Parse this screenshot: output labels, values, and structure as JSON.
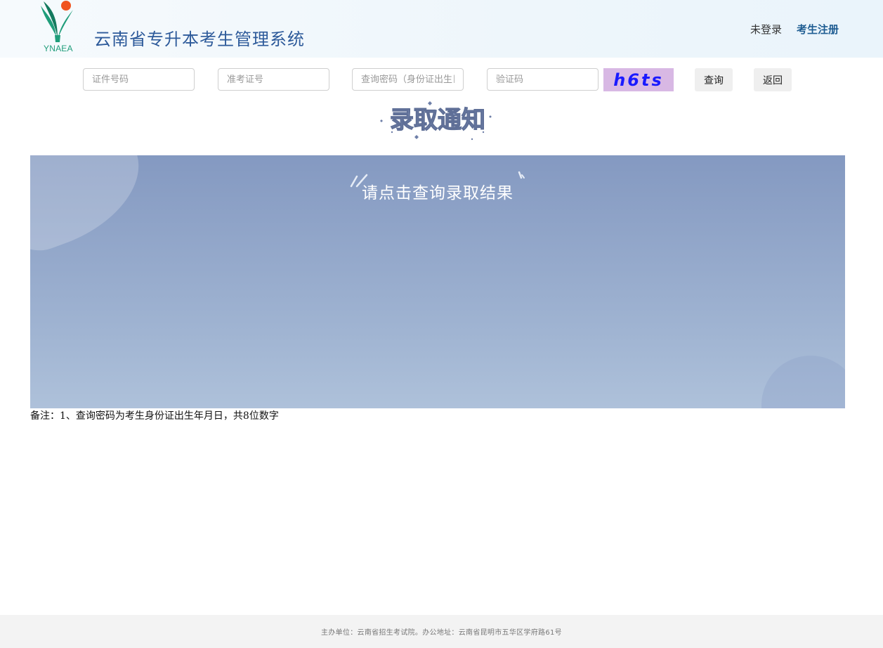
{
  "header": {
    "logo_text": "YNAEA",
    "title": "云南省专升本考生管理系统",
    "login_status": "未登录",
    "register_link": "考生注册"
  },
  "query_form": {
    "id_number_placeholder": "证件号码",
    "exam_ticket_placeholder": "准考证号",
    "password_placeholder": "查询密码（身份证出生日期）",
    "captcha_placeholder": "验证码",
    "captcha_text": "h6ts",
    "query_button": "查询",
    "back_button": "返回"
  },
  "notice": {
    "heading_art_text": "录取通知",
    "banner_text": "请点击查询录取结果"
  },
  "note": "备注：1、查询密码为考生身份证出生年月日，共8位数字",
  "footer": {
    "text": "主办单位：云南省招生考试院。办公地址：云南省昆明市五华区学府路61号"
  },
  "colors": {
    "title": "#2d5a9a",
    "register_link": "#1e5c92",
    "captcha_bg": "#d8b8e4",
    "captcha_text": "#1a1aff",
    "banner_top": "#8499c1",
    "banner_bottom": "#aec1da"
  }
}
